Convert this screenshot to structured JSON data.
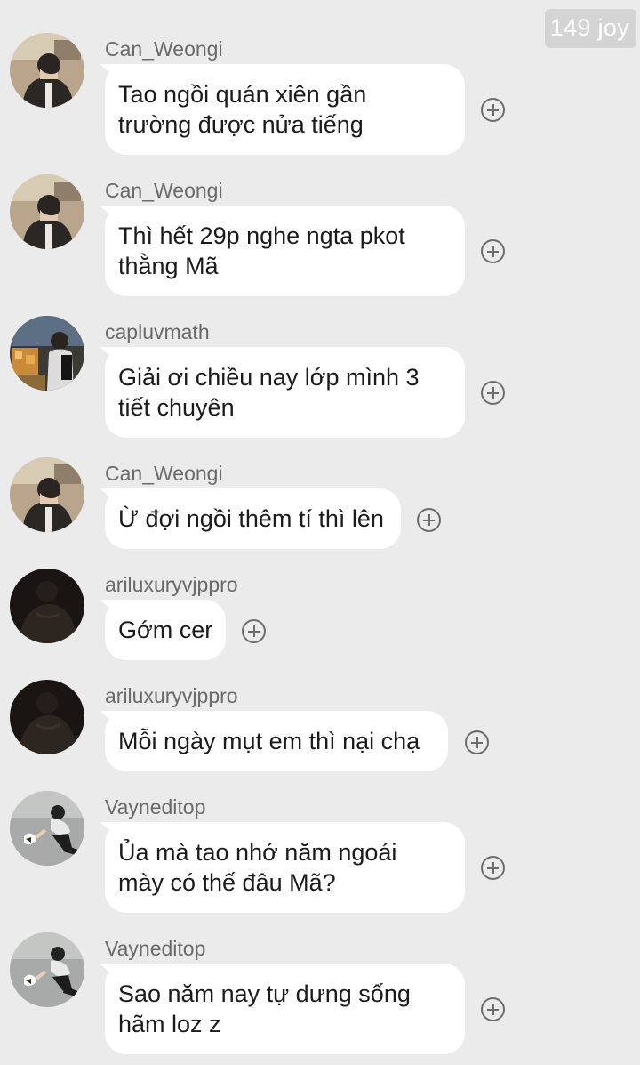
{
  "watermark": "149 joy",
  "messages": [
    {
      "sender": "Can_Weongi",
      "avatar": "boy-covering-face",
      "lines": [
        "Tao ngồi quán xiên gần",
        "trường được nửa tiếng"
      ]
    },
    {
      "sender": "Can_Weongi",
      "avatar": "boy-covering-face",
      "lines": [
        "Thì hết 29p nghe ngta pkot",
        "thằng Mã"
      ]
    },
    {
      "sender": "capluvmath",
      "avatar": "student-in-shop",
      "lines": [
        "Giải ơi chiều nay lớp mình 3",
        "tiết chuyên"
      ]
    },
    {
      "sender": "Can_Weongi",
      "avatar": "boy-covering-face",
      "lines": [
        "Ừ đợi ngồi thêm tí thì lên"
      ]
    },
    {
      "sender": "ariluxuryvjppro",
      "avatar": "dark-silhouette",
      "lines": [
        "Gớm cer"
      ]
    },
    {
      "sender": "ariluxuryvjppro",
      "avatar": "dark-silhouette",
      "lines": [
        "Mỗi ngày mụt em thì nại chạ"
      ]
    },
    {
      "sender": "Vayneditop",
      "avatar": "boy-petting-cat",
      "lines": [
        "Ủa mà tao nhớ năm ngoái",
        "mày có thế đâu Mã?"
      ]
    },
    {
      "sender": "Vayneditop",
      "avatar": "boy-petting-cat",
      "lines": [
        "Sao năm nay tự dưng sống",
        "hãm loz z"
      ]
    }
  ],
  "react_icon": "add-reaction-icon",
  "colors": {
    "background": "#ebebeb",
    "bubble": "#ffffff",
    "sender": "#6a6a6a",
    "text": "#1b1b1b"
  }
}
